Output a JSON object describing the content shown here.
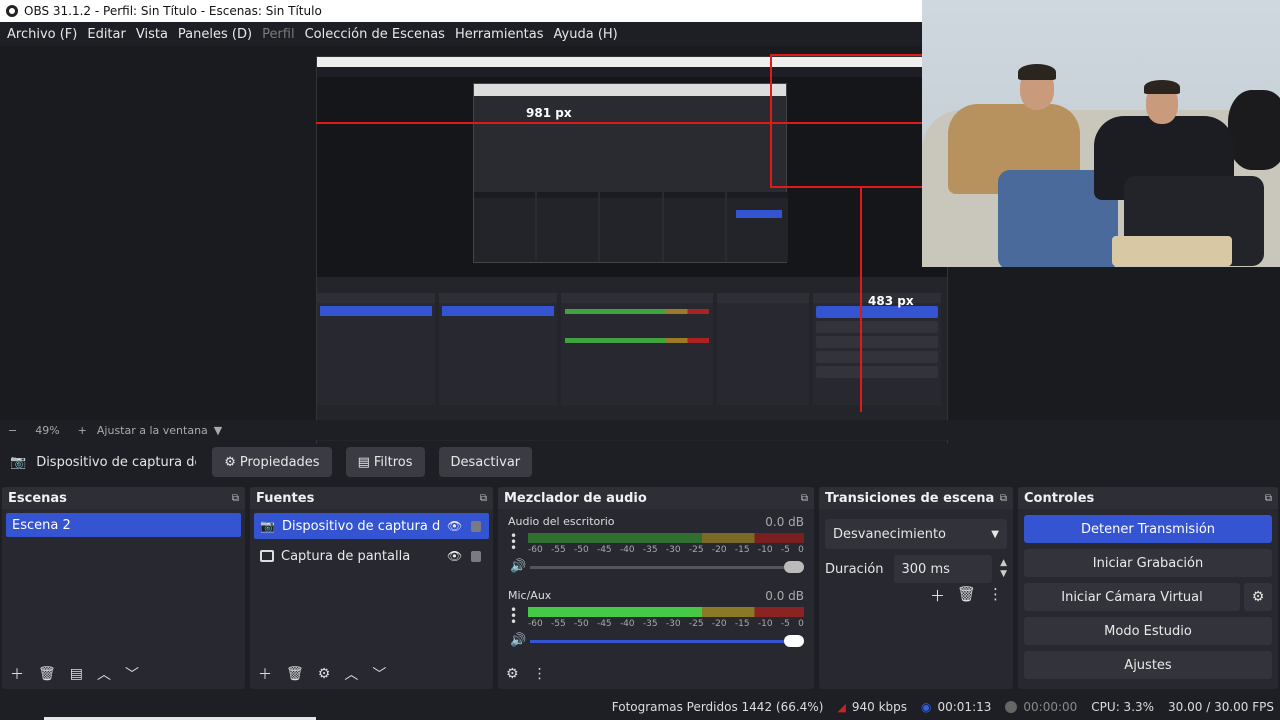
{
  "window": {
    "title": "OBS 31.1.2 - Perfil: Sin Título - Escenas: Sin Título"
  },
  "menu": [
    {
      "label": "Archivo (F)",
      "disabled": false
    },
    {
      "label": "Editar",
      "disabled": false
    },
    {
      "label": "Vista",
      "disabled": false
    },
    {
      "label": "Paneles (D)",
      "disabled": false
    },
    {
      "label": "Perfil",
      "disabled": true
    },
    {
      "label": "Colección de Escenas",
      "disabled": false
    },
    {
      "label": "Herramientas",
      "disabled": false
    },
    {
      "label": "Ayuda (H)",
      "disabled": false
    }
  ],
  "preview": {
    "measure_horizontal": "981 px",
    "measure_vertical": "483 px"
  },
  "zoom": {
    "minus": "−",
    "level": "49%",
    "plus": "+",
    "fit_label": "Ajustar a la ventana"
  },
  "source_toolbar": {
    "source_name": "Dispositivo de captura de v",
    "properties": "Propiedades",
    "filters": "Filtros",
    "deactivate": "Desactivar"
  },
  "scenes": {
    "title": "Escenas",
    "items": [
      "Escena 2"
    ]
  },
  "sources": {
    "title": "Fuentes",
    "items": [
      {
        "label": "Dispositivo de captura de vídeo",
        "selected": true
      },
      {
        "label": "Captura de pantalla",
        "selected": false
      }
    ]
  },
  "mixer": {
    "title": "Mezclador de audio",
    "ticks": [
      "-60",
      "-55",
      "-50",
      "-45",
      "-40",
      "-35",
      "-30",
      "-25",
      "-20",
      "-15",
      "-10",
      "-5",
      "0"
    ],
    "channels": [
      {
        "name": "Audio del escritorio",
        "db": "0.0 dB"
      },
      {
        "name": "Mic/Aux",
        "db": "0.0 dB"
      }
    ]
  },
  "transitions": {
    "title": "Transiciones de escena",
    "selected": "Desvanecimiento",
    "duration_label": "Duración",
    "duration_value": "300 ms"
  },
  "controls": {
    "title": "Controles",
    "stop_stream": "Detener Transmisión",
    "start_recording": "Iniciar Grabación",
    "start_virtual_cam": "Iniciar Cámara Virtual",
    "studio_mode": "Modo Estudio",
    "settings": "Ajustes"
  },
  "status": {
    "dropped_frames": "Fotogramas Perdidos 1442 (66.4%)",
    "bitrate": "940 kbps",
    "stream_time": "00:01:13",
    "record_time": "00:00:00",
    "cpu": "CPU: 3.3%",
    "fps": "30.00 / 30.00 FPS"
  },
  "colors": {
    "accent": "#3454d1",
    "measure_line": "#e01919"
  }
}
